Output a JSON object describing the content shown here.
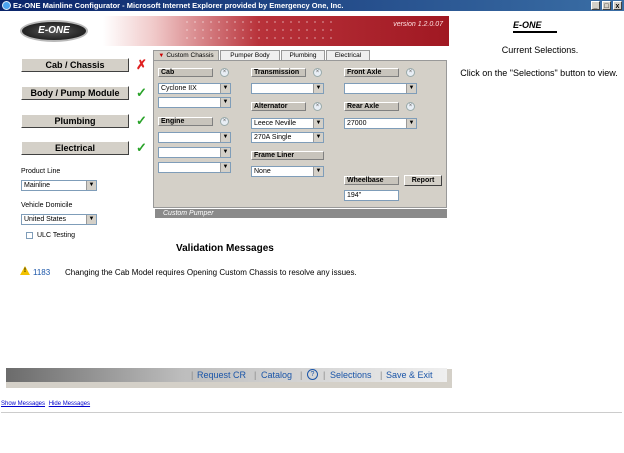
{
  "window": {
    "title": "Ez-ONE Mainline Configurator - Microsoft Internet Explorer provided by Emergency One, Inc.",
    "min_glyph": "_",
    "max_glyph": "□",
    "close_glyph": "x"
  },
  "header": {
    "logo_text": "E-ONE",
    "version": "version 1.2.0.07"
  },
  "nav": {
    "cab_chassis": {
      "label": "Cab / Chassis",
      "status_glyph": "✗"
    },
    "body_pump": {
      "label": "Body / Pump Module",
      "status_glyph": "✓"
    },
    "plumbing": {
      "label": "Plumbing",
      "status_glyph": "✓"
    },
    "electrical": {
      "label": "Electrical",
      "status_glyph": "✓"
    }
  },
  "left_fields": {
    "product_line_label": "Product Line",
    "product_line_value": "Mainline",
    "vehicle_domicile_label": "Vehicle Domicile",
    "vehicle_domicile_value": "United States",
    "ulc_testing_label": "ULC Testing"
  },
  "tabs": {
    "custom_chassis": "Custom Chassis",
    "pumper_body": "Pumper Body",
    "plumbing": "Plumbing",
    "electrical": "Electrical"
  },
  "chassis": {
    "cab_label": "Cab",
    "cab_value": "Cyclone IIX",
    "engine_label": "Engine",
    "transmission_label": "Transmission",
    "alternator_label": "Alternator",
    "alternator_value_1": "Leece Neville",
    "alternator_value_2": "270A Single",
    "frame_liner_label": "Frame Liner",
    "frame_liner_value": "None",
    "front_axle_label": "Front Axle",
    "rear_axle_label": "Rear Axle",
    "rear_axle_value": "27000",
    "wheelbase_label": "Wheelbase",
    "wheelbase_value": "194\"",
    "report_label": "Report",
    "clear_glyph": "×"
  },
  "status_strip": "Custom Pumper",
  "validation": {
    "title": "Validation Messages",
    "code": "1183",
    "message": "Changing the Cab Model requires Opening Custom Chassis to resolve any issues."
  },
  "footer": {
    "request_cr": "Request CR",
    "catalog": "Catalog",
    "help": "?",
    "selections": "Selections",
    "save_exit": "Save & Exit",
    "sep": "|"
  },
  "right_panel": {
    "logo_text": "E-ONE",
    "current_selections": "Current Selections.",
    "instructions": "Click on the \"Selections\" button to view."
  },
  "bottom": {
    "show_messages": "Show Messages",
    "hide_messages": "Hide Messages"
  },
  "colors": {
    "accent_red": "#b8323a",
    "link_blue": "#1a55a8",
    "check_green": "#29a329",
    "x_red": "#e02020"
  }
}
